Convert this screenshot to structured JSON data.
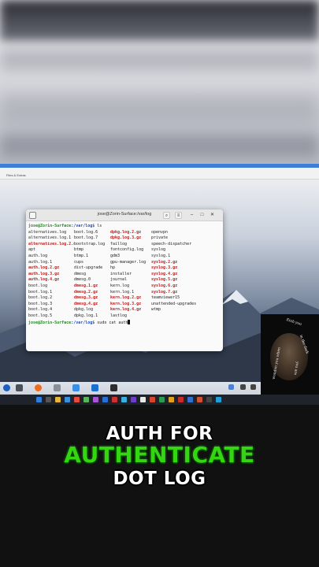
{
  "app_menubar": "Files & Extras",
  "terminal": {
    "title": "jose@Zorin-Surface:/var/log",
    "prompt_user": "jose@Zorin-Surface",
    "prompt_path": ":/var/log",
    "cmd1": "$ ls",
    "cmd2": "$ sudo cat auth",
    "listing": [
      [
        {
          "t": "alternatives.log",
          "r": false
        },
        {
          "t": "boot.log.6",
          "r": false
        },
        {
          "t": "dpkg.log.2.gz",
          "r": true
        },
        {
          "t": "openvpn",
          "r": false
        }
      ],
      [
        {
          "t": "alternatives.log.1",
          "r": false
        },
        {
          "t": "boot.log.7",
          "r": false
        },
        {
          "t": "dpkg.log.3.gz",
          "r": true
        },
        {
          "t": "private",
          "r": false
        }
      ],
      [
        {
          "t": "alternatives.log.2.gz",
          "r": true
        },
        {
          "t": "bootstrap.log",
          "r": false
        },
        {
          "t": "faillog",
          "r": false
        },
        {
          "t": "speech-dispatcher",
          "r": false
        }
      ],
      [
        {
          "t": "apt",
          "r": false
        },
        {
          "t": "btmp",
          "r": false
        },
        {
          "t": "fontconfig.log",
          "r": false
        },
        {
          "t": "syslog",
          "r": false
        }
      ],
      [
        {
          "t": "auth.log",
          "r": false
        },
        {
          "t": "btmp.1",
          "r": false
        },
        {
          "t": "gdm3",
          "r": false
        },
        {
          "t": "syslog.1",
          "r": false
        }
      ],
      [
        {
          "t": "auth.log.1",
          "r": false
        },
        {
          "t": "cups",
          "r": false
        },
        {
          "t": "gpu-manager.log",
          "r": false
        },
        {
          "t": "syslog.2.gz",
          "r": true
        }
      ],
      [
        {
          "t": "auth.log.2.gz",
          "r": true
        },
        {
          "t": "dist-upgrade",
          "r": false
        },
        {
          "t": "hp",
          "r": false
        },
        {
          "t": "syslog.3.gz",
          "r": true
        }
      ],
      [
        {
          "t": "auth.log.3.gz",
          "r": true
        },
        {
          "t": "dmesg",
          "r": false
        },
        {
          "t": "installer",
          "r": false
        },
        {
          "t": "syslog.4.gz",
          "r": true
        }
      ],
      [
        {
          "t": "auth.log.4.gz",
          "r": true
        },
        {
          "t": "dmesg.0",
          "r": false
        },
        {
          "t": "journal",
          "r": false
        },
        {
          "t": "syslog.5.gz",
          "r": true
        }
      ],
      [
        {
          "t": "boot.log",
          "r": false
        },
        {
          "t": "dmesg.1.gz",
          "r": true
        },
        {
          "t": "kern.log",
          "r": false
        },
        {
          "t": "syslog.6.gz",
          "r": true
        }
      ],
      [
        {
          "t": "boot.log.1",
          "r": false
        },
        {
          "t": "dmesg.2.gz",
          "r": true
        },
        {
          "t": "kern.log.1",
          "r": false
        },
        {
          "t": "syslog.7.gz",
          "r": true
        }
      ],
      [
        {
          "t": "boot.log.2",
          "r": false
        },
        {
          "t": "dmesg.3.gz",
          "r": true
        },
        {
          "t": "kern.log.2.gz",
          "r": true
        },
        {
          "t": "teamviewer15",
          "r": false
        }
      ],
      [
        {
          "t": "boot.log.3",
          "r": false
        },
        {
          "t": "dmesg.4.gz",
          "r": true
        },
        {
          "t": "kern.log.3.gz",
          "r": true
        },
        {
          "t": "unattended-upgrades",
          "r": false
        }
      ],
      [
        {
          "t": "boot.log.4",
          "r": false
        },
        {
          "t": "dpkg.log",
          "r": false
        },
        {
          "t": "kern.log.4.gz",
          "r": true
        },
        {
          "t": "wtmp",
          "r": false
        }
      ],
      [
        {
          "t": "boot.log.5",
          "r": false
        },
        {
          "t": "dpkg.log.1",
          "r": false
        },
        {
          "t": "lastlog",
          "r": false
        },
        {
          "t": "",
          "r": false
        }
      ]
    ]
  },
  "webcam": {
    "text1": "Einh you",
    "text2": "in the dark",
    "text3": "you are",
    "text4": "wondon you when"
  },
  "caption": {
    "line1": "AUTH FOR",
    "line2": "AUTHENTICATE",
    "line3": "DOT LOG"
  },
  "colors": {
    "caption_accent": "#34d611",
    "red_file": "#c41c1c",
    "prompt_user": "#1e8a1e",
    "prompt_path": "#1d4ecb"
  },
  "icons": [
    "terminal-icon",
    "search-icon",
    "menu-icon",
    "minimize-icon",
    "maximize-icon",
    "close-icon",
    "zorin-icon",
    "firefox-icon",
    "files-icon",
    "store-icon",
    "teamviewer-icon",
    "terminal-dock-icon"
  ]
}
